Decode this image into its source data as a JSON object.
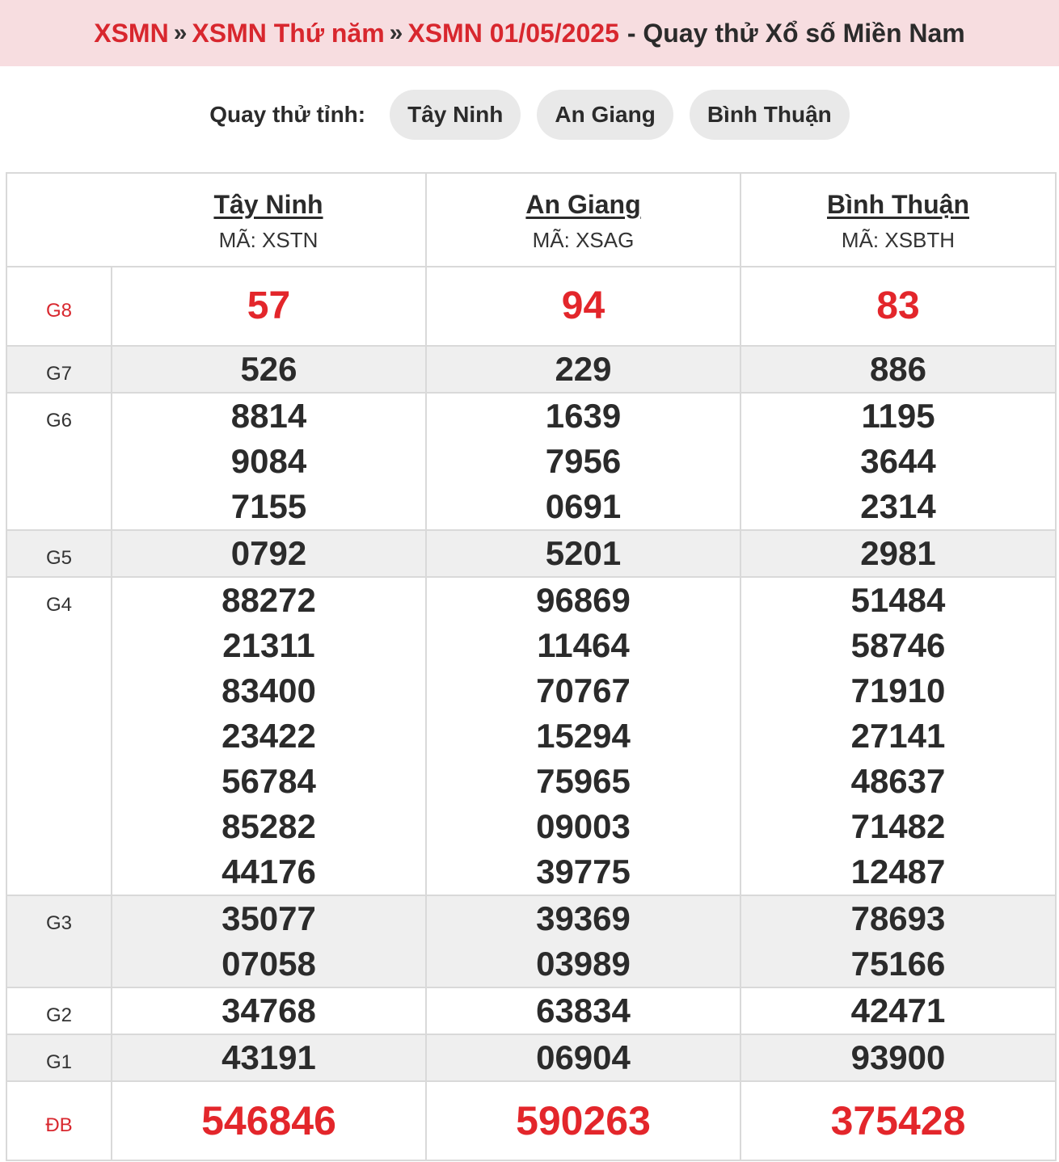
{
  "breadcrumb": {
    "item1": "XSMN",
    "item2": "XSMN Thứ năm",
    "item3": "XSMN 01/05/2025",
    "tail": "- Quay thử Xổ số Miền Nam",
    "separator": "»"
  },
  "province_selector": {
    "label": "Quay thử tỉnh:",
    "options": [
      "Tây Ninh",
      "An Giang",
      "Bình Thuận"
    ]
  },
  "table": {
    "provinces": [
      {
        "name": "Tây Ninh",
        "code": "MÃ: XSTN"
      },
      {
        "name": "An Giang",
        "code": "MÃ: XSAG"
      },
      {
        "name": "Bình Thuận",
        "code": "MÃ: XSBTH"
      }
    ],
    "prizes": [
      {
        "label": "G8",
        "values": [
          [
            "57"
          ],
          [
            "94"
          ],
          [
            "83"
          ]
        ]
      },
      {
        "label": "G7",
        "values": [
          [
            "526"
          ],
          [
            "229"
          ],
          [
            "886"
          ]
        ]
      },
      {
        "label": "G6",
        "values": [
          [
            "8814",
            "9084",
            "7155"
          ],
          [
            "1639",
            "7956",
            "0691"
          ],
          [
            "1195",
            "3644",
            "2314"
          ]
        ]
      },
      {
        "label": "G5",
        "values": [
          [
            "0792"
          ],
          [
            "5201"
          ],
          [
            "2981"
          ]
        ]
      },
      {
        "label": "G4",
        "values": [
          [
            "88272",
            "21311",
            "83400",
            "23422",
            "56784",
            "85282",
            "44176"
          ],
          [
            "96869",
            "11464",
            "70767",
            "15294",
            "75965",
            "09003",
            "39775"
          ],
          [
            "51484",
            "58746",
            "71910",
            "27141",
            "48637",
            "71482",
            "12487"
          ]
        ]
      },
      {
        "label": "G3",
        "values": [
          [
            "35077",
            "07058"
          ],
          [
            "39369",
            "03989"
          ],
          [
            "78693",
            "75166"
          ]
        ]
      },
      {
        "label": "G2",
        "values": [
          [
            "34768"
          ],
          [
            "63834"
          ],
          [
            "42471"
          ]
        ]
      },
      {
        "label": "G1",
        "values": [
          [
            "43191"
          ],
          [
            "06904"
          ],
          [
            "93900"
          ]
        ]
      },
      {
        "label": "ĐB",
        "values": [
          [
            "546846"
          ],
          [
            "590263"
          ],
          [
            "375428"
          ]
        ]
      }
    ]
  },
  "colors": {
    "accent_red": "#d8272e",
    "header_bg": "#f7dde0",
    "shade_row": "#efefef",
    "pill_bg": "#e9e9e9"
  }
}
